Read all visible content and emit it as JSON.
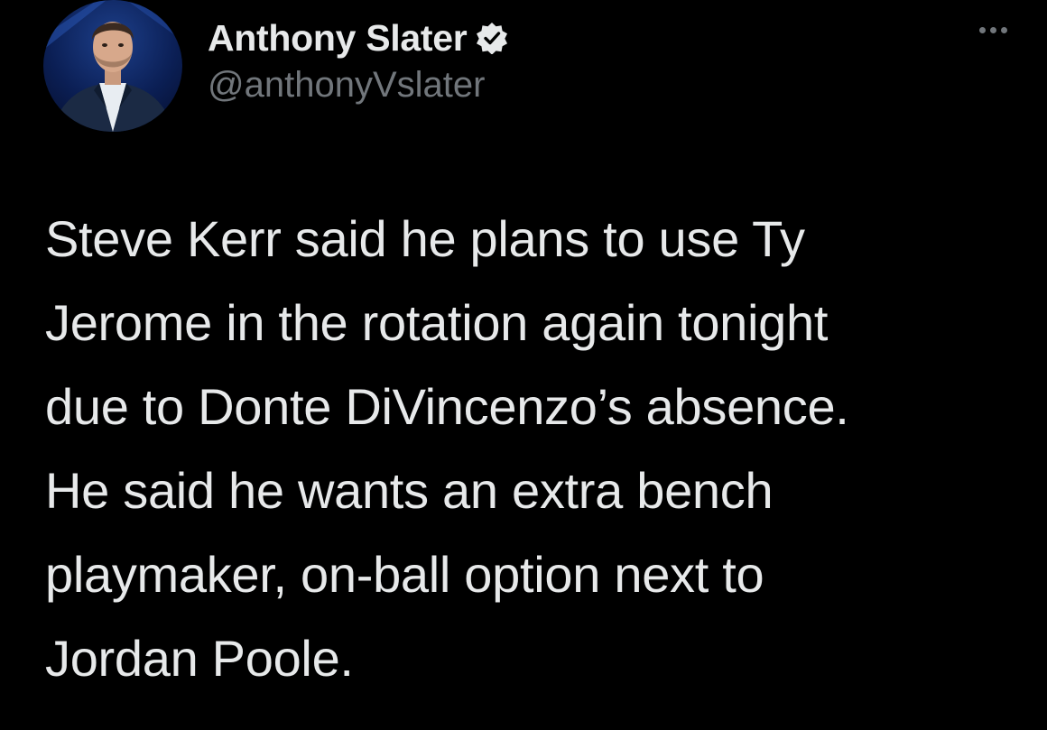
{
  "author": {
    "display_name": "Anthony Slater",
    "handle": "@anthonyVslater",
    "verified": true,
    "verified_color": "#e7e9ea"
  },
  "tweet": {
    "text": "Steve Kerr said he plans to use Ty\nJerome in the rotation again tonight\ndue to Donte DiVincenzo’s absence.\nHe said he wants an extra bench\nplaymaker, on-ball option next to\nJordan Poole."
  },
  "icons": {
    "more": "more-horizontal-icon",
    "verified": "verified-badge-icon",
    "avatar": "avatar-photo"
  },
  "colors": {
    "background": "#000000",
    "primary_text": "#e7e9ea",
    "secondary_text": "#71767b"
  }
}
